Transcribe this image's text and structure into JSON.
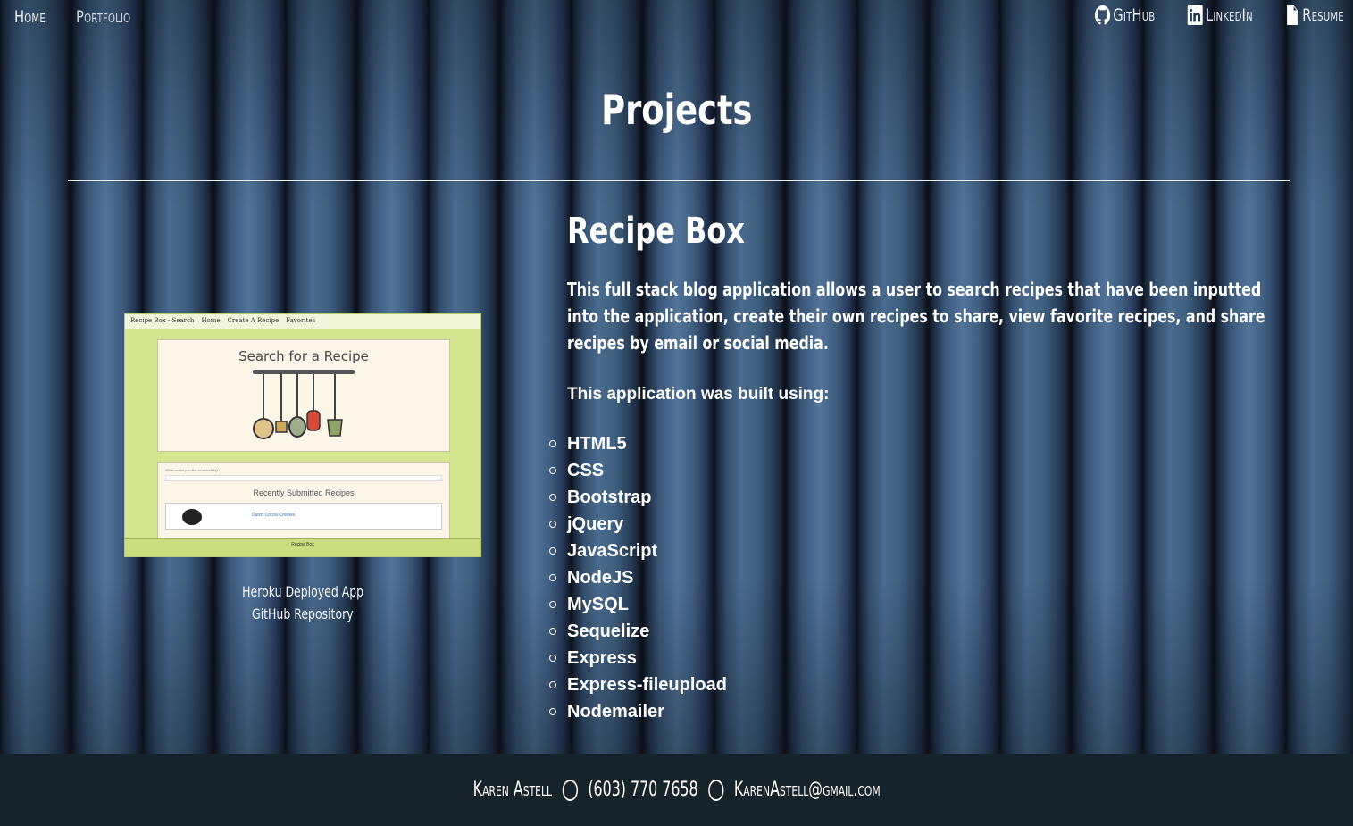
{
  "nav": {
    "home": "Home",
    "portfolio": "Portfolio",
    "github": "GitHub",
    "linkedin": "LinkedIn",
    "resume": "Resume"
  },
  "page": {
    "title": "Projects"
  },
  "project": {
    "title": "Recipe Box",
    "description": "This full stack blog application allows a user to search recipes that have been inputted into the application, create their own recipes to share, view favorite recipes, and share recipes by email or social media.",
    "built_label": "This application was built using:",
    "technologies": [
      "HTML5",
      "CSS",
      "Bootstrap",
      "jQuery",
      "JavaScript",
      "NodeJS",
      "MySQL",
      "Sequelize",
      "Express",
      "Express-fileupload",
      "Nodemailer"
    ],
    "screenshot": {
      "nav_title": "Recipe Box - Search",
      "nav_items": [
        "Home",
        "Create A Recipe",
        "Favorites"
      ],
      "search_heading": "Search for a Recipe",
      "search_prompt": "What would you like to search by?",
      "recent_heading": "Recently Submitted Recipes",
      "recent_item": "Dutch Cocoa Cookies",
      "footer_text": "Recipe Box"
    },
    "links": {
      "heroku": "Heroku Deployed App",
      "github": "GitHub Repository"
    }
  },
  "footer": {
    "name": "Karen Astell",
    "phone": "(603) 770 7658",
    "email": "KarenAstell@gmail.com"
  }
}
